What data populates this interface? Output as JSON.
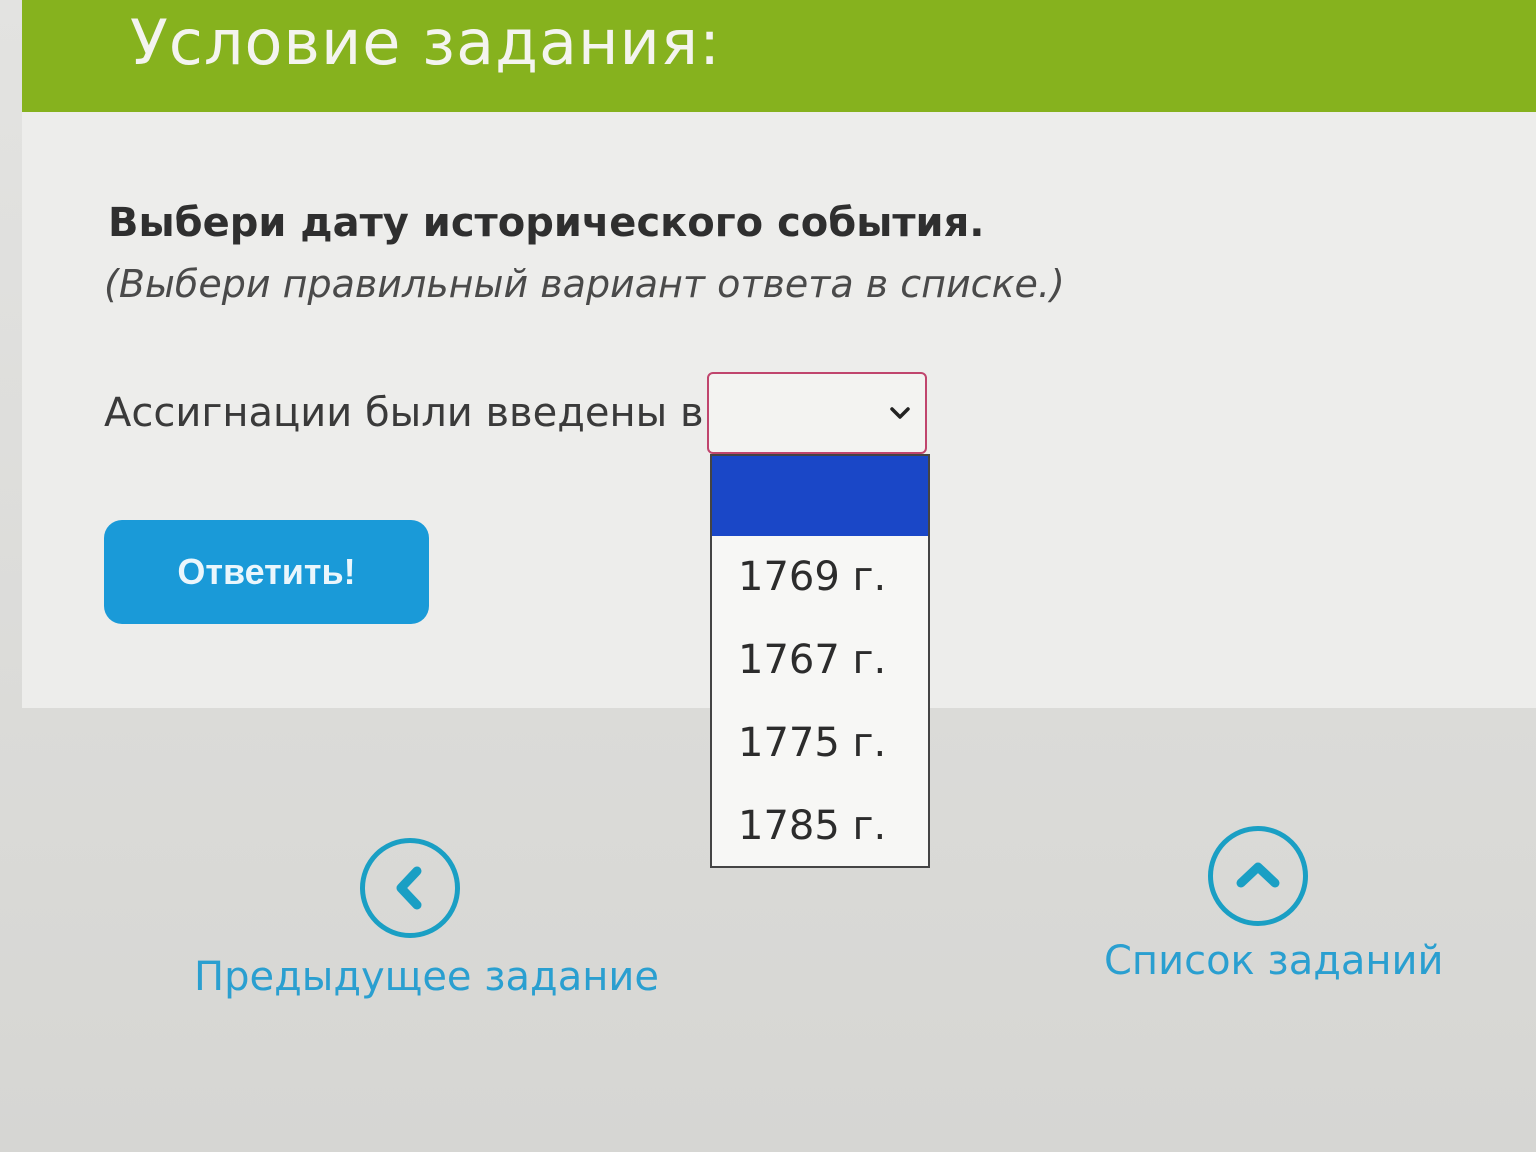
{
  "header": {
    "title": "Условие задания:"
  },
  "task": {
    "instruction": "Выбери дату исторического события.",
    "hint": "(Выбери правильный вариант ответа в списке.)",
    "question": "Ассигнации были введены в",
    "select": {
      "value": "",
      "options": [
        "",
        "1769 г.",
        "1767 г.",
        "1775 г.",
        "1785 г."
      ]
    },
    "answer_label": "Ответить!"
  },
  "nav": {
    "prev_label": "Предыдущее задание",
    "list_label": "Список заданий"
  },
  "colors": {
    "header": "#86b21e",
    "button": "#1a9ad8",
    "link": "#2a9fd0",
    "highlight": "#1a47c7"
  }
}
